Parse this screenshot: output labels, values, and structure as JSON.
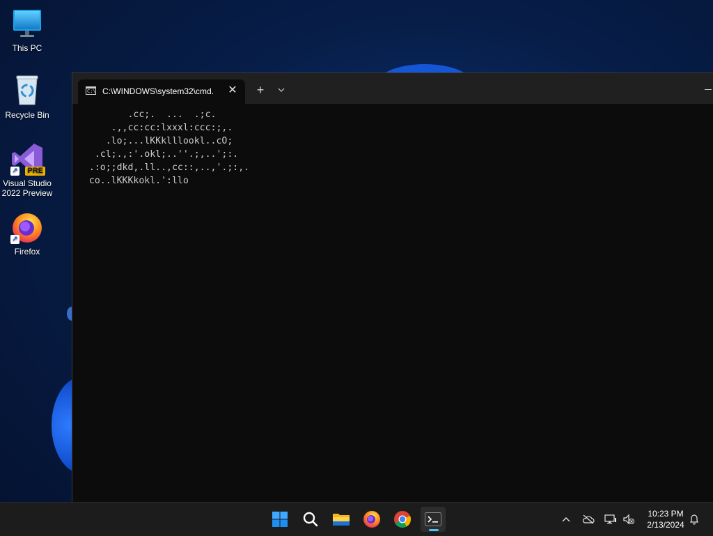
{
  "desktop": {
    "icons": [
      {
        "label": "This PC",
        "icon": "monitor-icon"
      },
      {
        "label": "Recycle Bin",
        "icon": "recycle-bin-icon"
      },
      {
        "label": "Visual Studio 2022 Preview",
        "icon": "visual-studio-icon",
        "badge": "PRE"
      },
      {
        "label": "Firefox",
        "icon": "firefox-icon"
      }
    ]
  },
  "terminal": {
    "tab_title": "C:\\WINDOWS\\system32\\cmd.",
    "tab_icon_text": "C:\\",
    "new_tab_label": "+",
    "output_lines": [
      "         .cc;.  ...  .;c.",
      "      .,,cc:cc:lxxxl:ccc:;,.",
      "     .lo;...lKKklllookl..cO;",
      "   .cl;.,:'.okl;..''.;,..';:.",
      "  .:o;;dkd,.ll..,cc::,..,'.;:,.",
      "  co..lKKKkokl.':llo"
    ]
  },
  "taskbar": {
    "apps": [
      {
        "name": "start",
        "icon": "windows-start-icon"
      },
      {
        "name": "search",
        "icon": "search-icon"
      },
      {
        "name": "file-explorer",
        "icon": "folder-icon"
      },
      {
        "name": "firefox",
        "icon": "firefox-icon"
      },
      {
        "name": "chrome",
        "icon": "chrome-icon"
      },
      {
        "name": "terminal",
        "icon": "terminal-icon",
        "active": true
      }
    ],
    "tray": {
      "time": "10:23 PM",
      "date": "2/13/2024"
    }
  },
  "colors": {
    "accent": "#4cc2ff",
    "console_bg": "#0c0c0c",
    "console_fg": "#cccccc",
    "titlebar": "#202020",
    "taskbar": "#1c1c1c"
  }
}
